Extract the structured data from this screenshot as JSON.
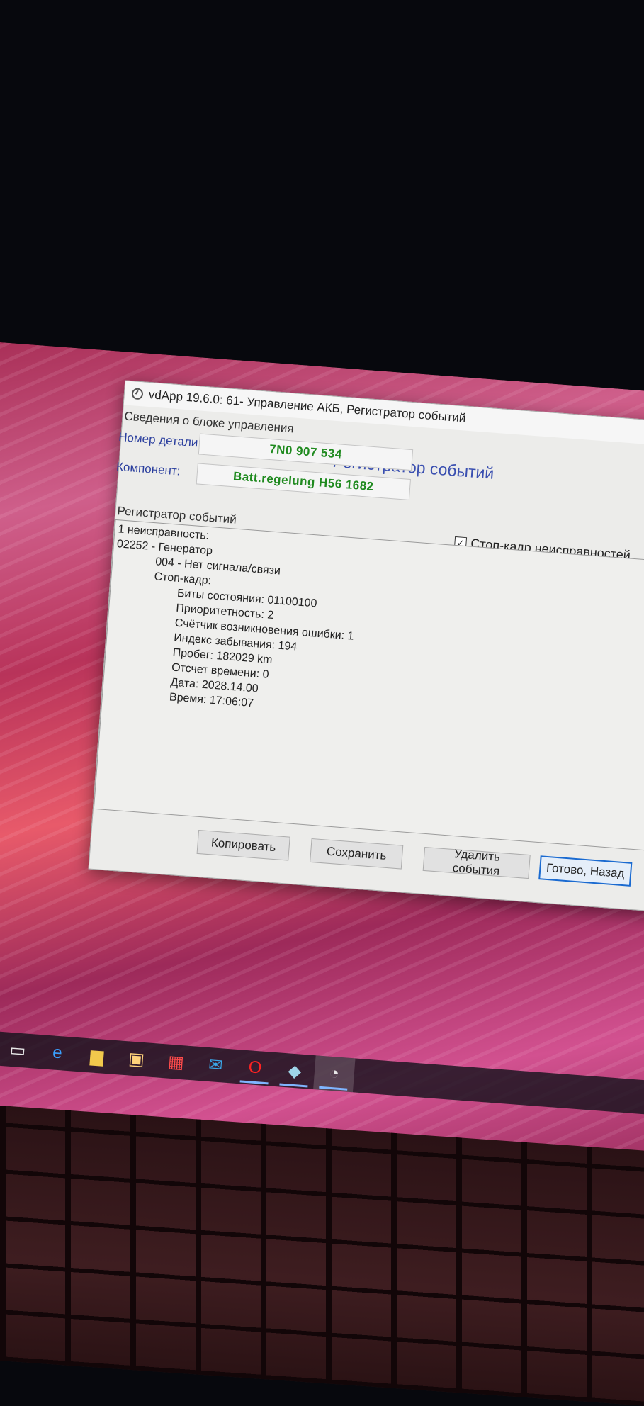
{
  "window": {
    "title": "vdApp 19.6.0: 61- Управление АКБ,  Регистратор событий"
  },
  "header": {
    "section_label": "Сведения о блоке управления",
    "heading": "Регистратор событий"
  },
  "fields": {
    "part_number_label": "Номер детали:",
    "part_number_value": "7N0 907 534",
    "component_label": "Компонент:",
    "component_value": "Batt.regelung H56 1682"
  },
  "freeze_frame": {
    "label": "Стоп-кадр неисправностей",
    "checked": true,
    "mark": "✓"
  },
  "event_log": {
    "group_label": "Регистратор событий",
    "fault_count": "1 неисправность:",
    "fault_code": "02252 - Генератор",
    "fault_detail": "004 - Нет сигнала/связи",
    "freeze_frame_title": "Стоп-кадр:",
    "status_bits": "Биты состояния: 01100100",
    "priority": "Приоритетность: 2",
    "occurrence_counter": "Счётчик возникновения ошибки: 1",
    "forget_index": "Индекс забывания: 194",
    "mileage": "Пробег: 182029 km",
    "time_indicator": "Отсчет времени: 0",
    "date": "Дата: 2028.14.00",
    "time": "Время: 17:06:07"
  },
  "buttons": {
    "copy": "Копировать",
    "save": "Сохранить",
    "delete_events": "Удалить события",
    "done_back": "Готово, Назад"
  },
  "taskbar": {
    "icons": [
      "windows-start-icon",
      "search-icon",
      "task-view-icon",
      "edge-icon",
      "file-explorer-icon",
      "store-icon",
      "gift-icon",
      "mail-icon",
      "opera-icon",
      "notes-icon",
      "vdapp-icon"
    ]
  }
}
